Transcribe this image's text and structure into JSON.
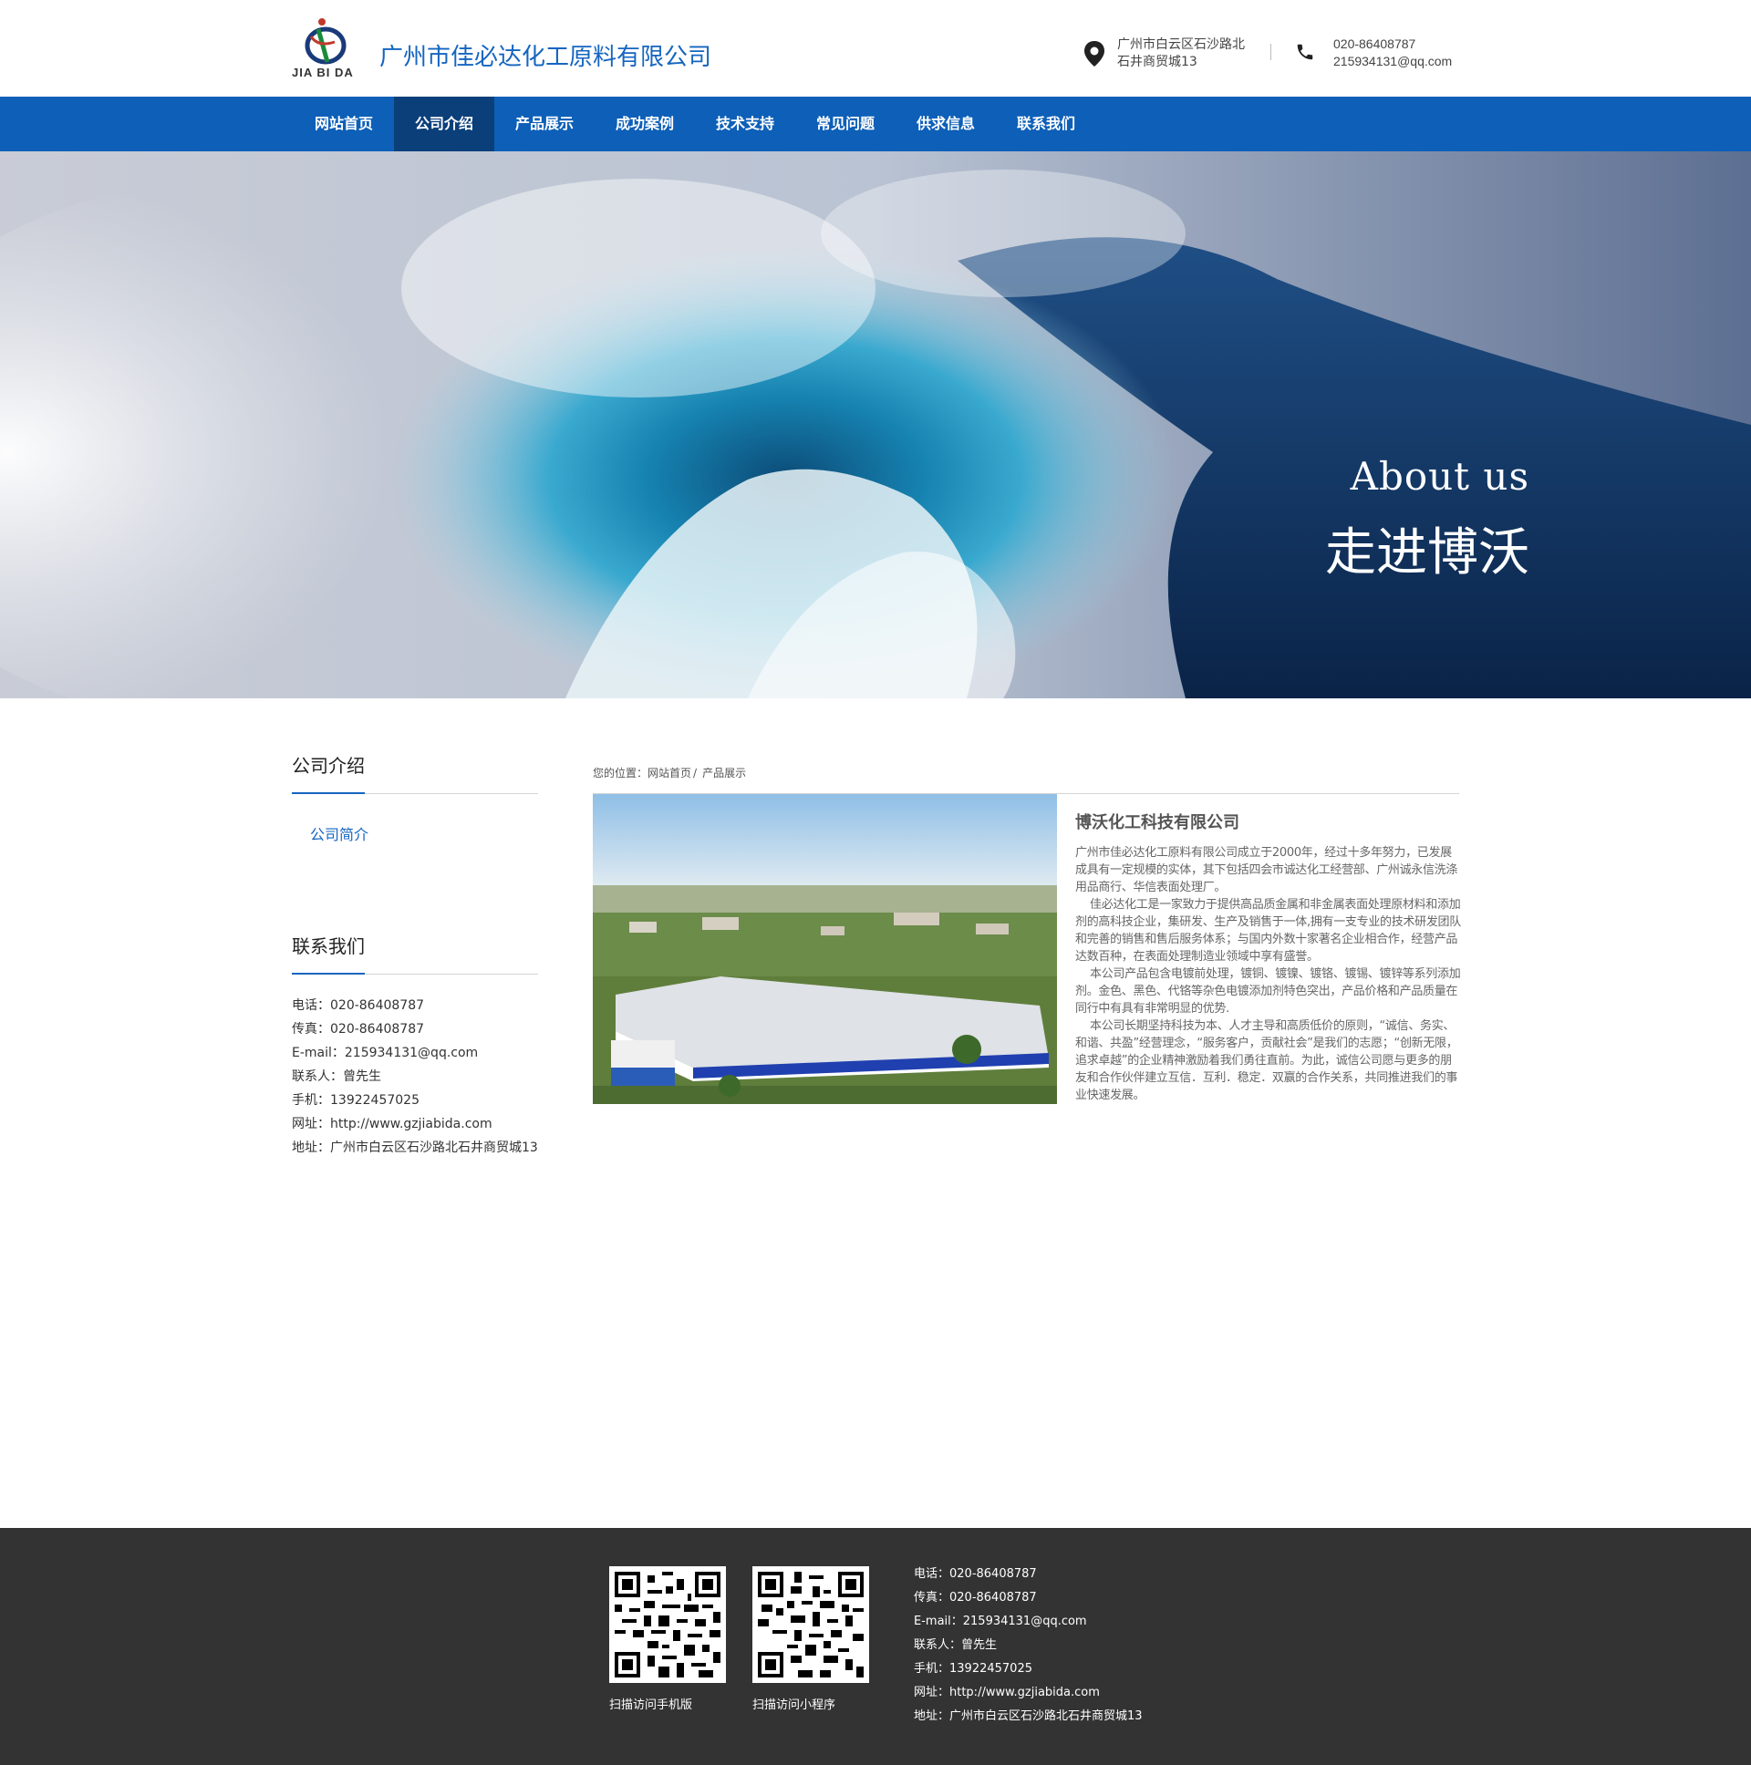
{
  "header": {
    "logo_text": "JIA BI DA",
    "company_name": "广州市佳必达化工原料有限公司",
    "address_line1": "广州市白云区石沙路北",
    "address_line2": "石井商贸城13",
    "phone": "020-86408787",
    "email": "215934131@qq.com",
    "icons": {
      "address": "map-pin-icon",
      "phone": "phone-icon"
    }
  },
  "nav": {
    "items": [
      {
        "label": "网站首页"
      },
      {
        "label": "公司介绍"
      },
      {
        "label": "产品展示"
      },
      {
        "label": "成功案例"
      },
      {
        "label": "技术支持"
      },
      {
        "label": "常见问题"
      },
      {
        "label": "供求信息"
      },
      {
        "label": "联系我们"
      }
    ],
    "active_index": 1
  },
  "banner": {
    "title_en": "About us",
    "title_cn": "走进博沃"
  },
  "sidebar": {
    "section1_title": "公司介绍",
    "section1_link": "公司简介",
    "section2_title": "联系我们",
    "contact": [
      "电话：020-86408787",
      "传真：020-86408787",
      "E-mail：215934131@qq.com",
      "联系人：曾先生",
      "手机：13922457025",
      "网址：http://www.gzjiabida.com",
      "地址：广州市白云区石沙路北石井商贸城13"
    ]
  },
  "main": {
    "breadcrumb_prefix": "您的位置：",
    "breadcrumb_home": "网站首页",
    "breadcrumb_sep": "/",
    "breadcrumb_current": "产品展示",
    "article_title": "博沃化工科技有限公司",
    "paragraphs": [
      "广州市佳必达化工原料有限公司成立于2000年，经过十多年努力，已发展成具有一定规模的实体，其下包括四会市诚达化工经营部、广州诚永信洗涤用品商行、华信表面处理厂。",
      "佳必达化工是一家致力于提供高品质金属和非金属表面处理原材料和添加剂的高科技企业，集研发、生产及销售于一体,拥有一支专业的技术研发团队和完善的销售和售后服务体系；与国内外数十家著名企业相合作，经营产品达数百种，在表面处理制造业领域中享有盛誉。",
      "本公司产品包含电镀前处理，镀铜、镀镍、镀铬、镀锡、镀锌等系列添加剂。金色、黑色、代铬等杂色电镀添加剂特色突出，产品价格和产品质量在同行中有具有非常明显的优势.",
      "本公司长期坚持科技为本、人才主导和高质低价的原则，“诚信、务实、和谐、共盈”经营理念，“服务客户，贡献社会”是我们的志愿；“创新无限，追求卓越”的企业精神激励着我们勇往直前。为此，诚信公司愿与更多的朋友和合作伙伴建立互信．互利．稳定．双赢的合作关系，共同推进我们的事业快速发展。"
    ]
  },
  "footer": {
    "qr1_label": "扫描访问手机版",
    "qr2_label": "扫描访问小程序",
    "contact": [
      "电话：020-86408787",
      "传真：020-86408787",
      "E-mail：215934131@qq.com",
      "联系人：曾先生",
      "手机：13922457025",
      "网址：http://www.gzjiabida.com",
      "地址：广州市白云区石沙路北石井商贸城13"
    ]
  },
  "colors": {
    "brand_blue": "#0d5fb8",
    "nav_active": "#0b3f7a",
    "footer_bg": "#333333",
    "link_blue": "#1565c0"
  }
}
